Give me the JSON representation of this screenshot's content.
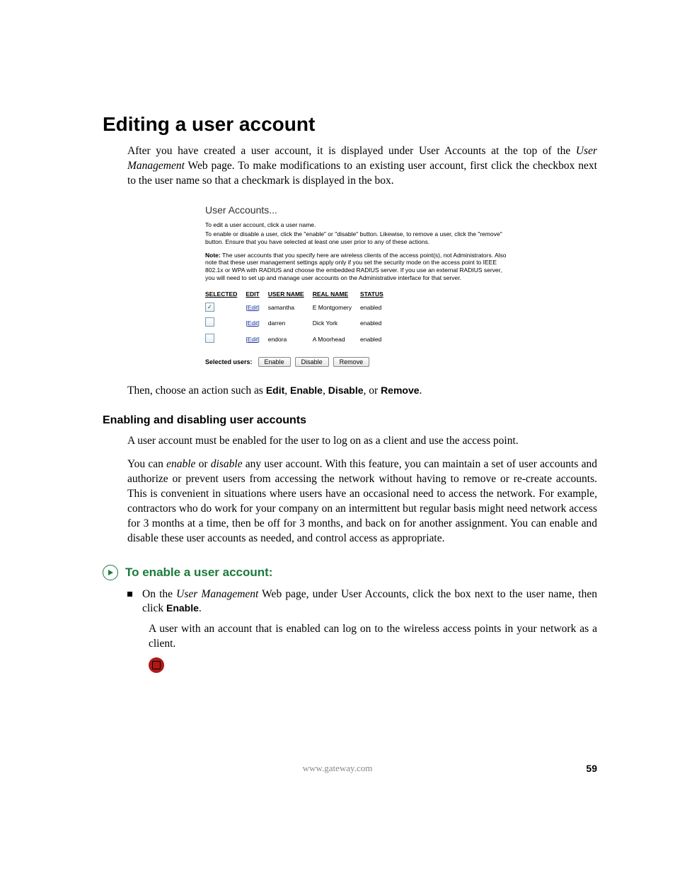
{
  "heading": "Editing a user account",
  "intro_p1_a": "After you have created a user account, it is displayed under User Accounts at the top of the ",
  "intro_p1_b": "User Management",
  "intro_p1_c": " Web page. To make modifications to an existing user account, first click the checkbox next to the user name so that a checkmark is displayed in the box.",
  "figure": {
    "title": "User Accounts...",
    "line1": "To edit a user account, click a user name.",
    "line2": "To enable or disable a user, click the \"enable\" or \"disable\" button. Likewise, to remove a user, click the \"remove\" button. Ensure that you have selected at least one user prior to any of these actions.",
    "note_bold": "Note:",
    "note_rest": " The user accounts that you specify here are wireless clients of the access point(s), not Administrators. Also note that these user management settings apply only if you set the security mode on the access point to IEEE 802.1x or WPA with RADIUS and choose the embedded RADIUS server. If you use an external RADIUS server, you will need to set up and manage user accounts on the Administrative interface for that server.",
    "cols": {
      "c1": "SELECTED",
      "c2": "EDIT",
      "c3": "USER NAME",
      "c4": "REAL NAME",
      "c5": "STATUS"
    },
    "rows": [
      {
        "checked": true,
        "edit": "[Edit]",
        "user": "samantha",
        "real": "E Montgomery",
        "status": "enabled"
      },
      {
        "checked": false,
        "edit": "[Edit]",
        "user": "darren",
        "real": "Dick York",
        "status": "enabled"
      },
      {
        "checked": false,
        "edit": "[Edit]",
        "user": "endora",
        "real": "A Moorhead",
        "status": "enabled"
      }
    ],
    "selected_label": "Selected users:",
    "btn_enable": "Enable",
    "btn_disable": "Disable",
    "btn_remove": "Remove"
  },
  "after_fig_a": "Then, choose an action such as ",
  "after_fig_edit": "Edit",
  "after_fig_sep": ", ",
  "after_fig_enable": "Enable",
  "after_fig_disable": "Disable",
  "after_fig_or": ", or ",
  "after_fig_remove": "Remove",
  "after_fig_period": ".",
  "sub_heading": "Enabling and disabling user accounts",
  "enable_p1": "A user account must be enabled for the user to log on as a client and use the access point.",
  "enable_p2_a": "You can ",
  "enable_p2_b": "enable",
  "enable_p2_c": " or ",
  "enable_p2_d": "disable",
  "enable_p2_e": " any user account. With this feature, you can maintain a set of user accounts and authorize or prevent users from accessing the network without having to remove or re-create accounts. This is convenient in situations where users have an occasional need to access the network. For example, contractors who do work for your company on an intermittent but regular basis might need network access for 3 months at a time, then be off for 3 months, and back on for another assignment. You can enable and disable these user accounts as needed, and control access as appropriate.",
  "proc_title": "To enable a user account:",
  "bullet_a": "On the ",
  "bullet_b": "User Management",
  "bullet_c": " Web page, under User Accounts, click the box next to the user name, then click ",
  "bullet_enable": "Enable",
  "bullet_period": ".",
  "bullet_sub": "A user with an account that is enabled can log on to the wireless access points in your network as a client.",
  "footer_url": "www.gateway.com",
  "page_number": "59"
}
